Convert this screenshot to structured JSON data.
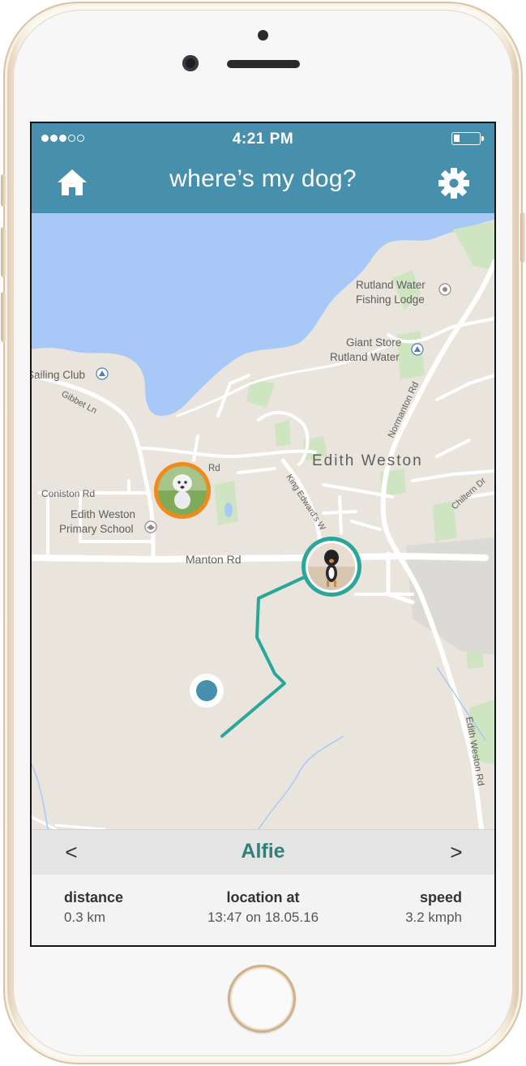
{
  "status_bar": {
    "time": "4:21 PM",
    "signal_bars_filled": 3,
    "signal_bars_total": 5
  },
  "header": {
    "title": "where’s my dog?",
    "left_icon": "home-icon",
    "right_icon": "gear-icon"
  },
  "map": {
    "labels": {
      "fishing_lodge_1": "Rutland Water",
      "fishing_lodge_2": "Fishing Lodge",
      "giant_store_1": "Giant Store",
      "giant_store_2": "Rutland Water",
      "sailing_club": "Sailing Club",
      "gibbet_ln": "Gibbet Ln",
      "normanton_rd": "Normanton Rd",
      "edith_weston": "Edith Weston",
      "king_edwards": "King Edward's W",
      "rd_fragment": "Rd",
      "chiltern_dr": "Chiltern Dr",
      "coniston_rd": "Coniston Rd",
      "school_1": "Edith Weston",
      "school_2": "Primary School",
      "manton_rd": "Manton Rd",
      "edith_weston_rd": "Edith Weston Rd"
    },
    "markers": [
      {
        "name": "other-dog",
        "ring_color": "#f08a1c"
      },
      {
        "name": "alfie",
        "ring_color": "#2aa69a"
      }
    ],
    "track_color": "#2aa69a",
    "owner_dot_color": "#4690ad"
  },
  "fab": {
    "icon": "more-vertical-icon"
  },
  "selector": {
    "prev": "<",
    "name": "Alfie",
    "next": ">"
  },
  "info": {
    "distance_label": "distance",
    "distance_value": "0.3 km",
    "location_label": "location at",
    "location_value": "13:47 on 18.05.16",
    "speed_label": "speed",
    "speed_value": "3.2 kmph"
  },
  "colors": {
    "primary": "#4690ad",
    "accent": "#2f8078",
    "water": "#a8c8f8",
    "land": "#e9e5dc",
    "park": "#cfe5c2"
  }
}
